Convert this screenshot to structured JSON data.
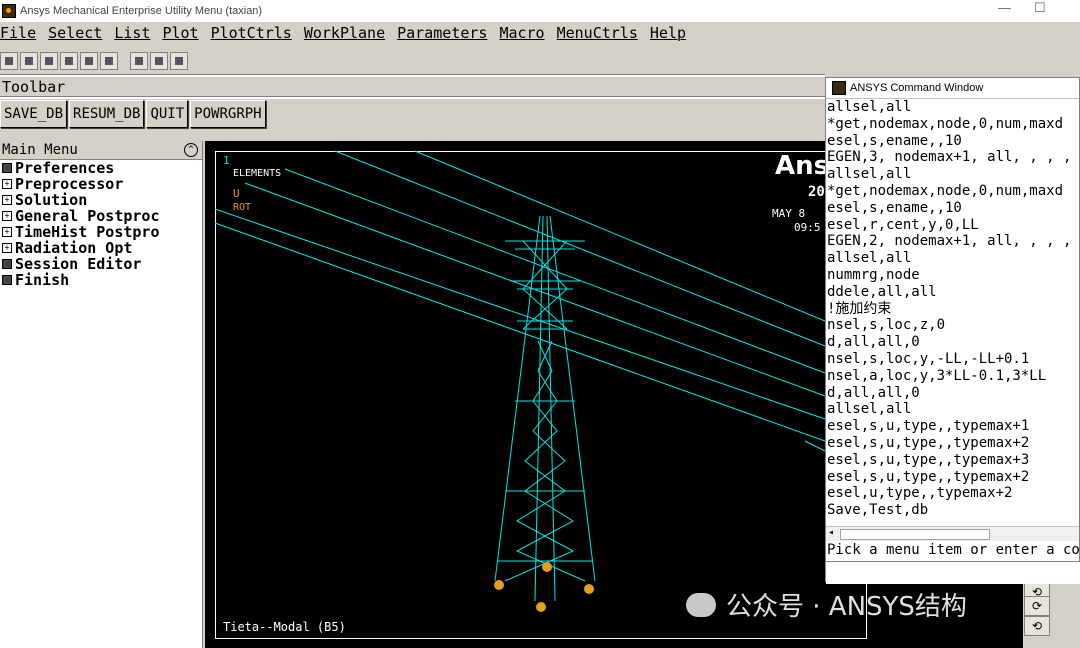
{
  "window": {
    "title": "Ansys Mechanical Enterprise Utility Menu (taxian)",
    "minimize": "—",
    "maximize": "☐"
  },
  "menubar": [
    "File",
    "Select",
    "List",
    "Plot",
    "PlotCtrls",
    "WorkPlane",
    "Parameters",
    "Macro",
    "MenuCtrls",
    "Help"
  ],
  "iconbar": [
    "new-icon",
    "open-icon",
    "save-icon",
    "model-icon",
    "print-icon",
    "help-icon",
    "raise-icon",
    "reset-icon",
    "report-icon"
  ],
  "toolbar": {
    "label": "Toolbar",
    "buttons": [
      "SAVE_DB",
      "RESUM_DB",
      "QUIT",
      "POWRGRPH"
    ]
  },
  "main_menu": {
    "title": "Main Menu",
    "items": [
      {
        "label": "Preferences",
        "marker": "box"
      },
      {
        "label": "Preprocessor",
        "marker": "plus"
      },
      {
        "label": "Solution",
        "marker": "plus"
      },
      {
        "label": "General Postproc",
        "marker": "plus"
      },
      {
        "label": "TimeHist Postpro",
        "marker": "plus"
      },
      {
        "label": "Radiation Opt",
        "marker": "plus"
      },
      {
        "label": "Session Editor",
        "marker": "box"
      },
      {
        "label": "Finish",
        "marker": "box"
      }
    ]
  },
  "graphics": {
    "window_number": "1",
    "label_elements": "ELEMENTS",
    "label_u": "U",
    "label_rot": "ROT",
    "logo_text": "Ans",
    "logo_year": "20",
    "date": "MAY  8",
    "time": "09:5",
    "footer": "Tieta--Modal (B5)",
    "line_color": "#00e5e5"
  },
  "command_window": {
    "title": "ANSYS Command Window",
    "lines": [
      "allsel,all",
      "*get,nodemax,node,0,num,maxd",
      "esel,s,ename,,10",
      "EGEN,3, nodemax+1, all, , , , ,",
      "allsel,all",
      "*get,nodemax,node,0,num,maxd",
      "esel,s,ename,,10",
      "esel,r,cent,y,0,LL",
      "EGEN,2, nodemax+1, all, , , , ,",
      "allsel,all",
      "nummrg,node",
      "ddele,all,all",
      "!施加约束",
      "nsel,s,loc,z,0",
      "d,all,all,0",
      "nsel,s,loc,y,-LL,-LL+0.1",
      "nsel,a,loc,y,3*LL-0.1,3*LL",
      "d,all,all,0",
      "allsel,all",
      "esel,s,u,type,,typemax+1",
      "esel,s,u,type,,typemax+2",
      "esel,s,u,type,,typemax+3",
      "esel,s,u,type,,typemax+2",
      "esel,u,type,,typemax+2",
      "Save,Test,db"
    ],
    "scroll_arrow": "◂",
    "prompt": "Pick a menu item or enter a comm",
    "input_value": ""
  },
  "watermark": "公众号 · ANSYS结构"
}
